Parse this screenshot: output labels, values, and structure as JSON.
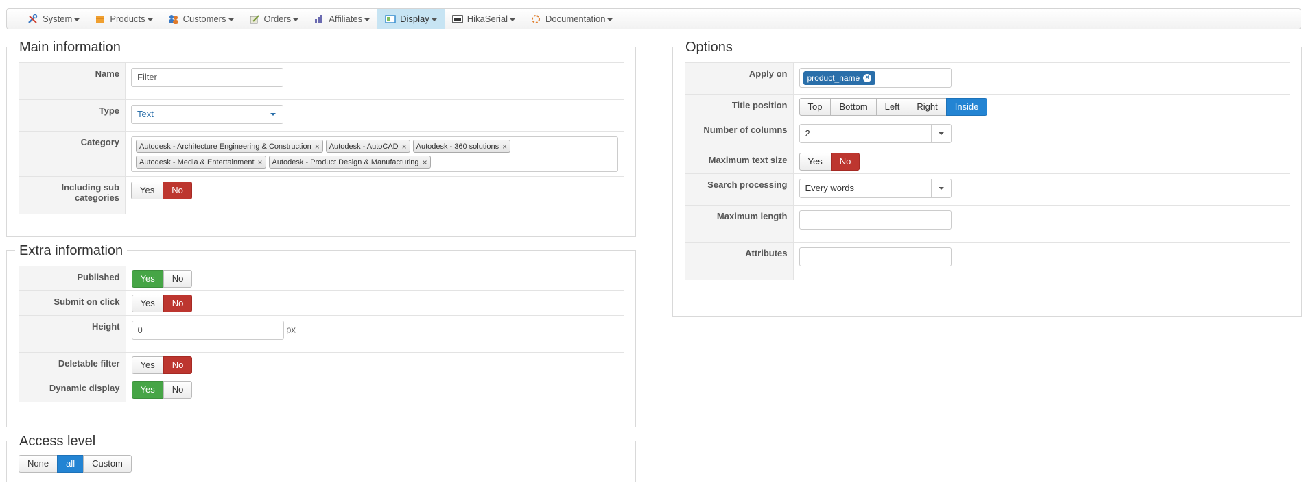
{
  "menu": [
    {
      "label": "System",
      "icon": "tools-icon",
      "color": "#3a79c4"
    },
    {
      "label": "Products",
      "icon": "products-box-icon",
      "color": "#f0a030"
    },
    {
      "label": "Customers",
      "icon": "customers-icon",
      "color": "#e07a2a"
    },
    {
      "label": "Orders",
      "icon": "orders-icon",
      "color": "#7a9a3a"
    },
    {
      "label": "Affiliates",
      "icon": "affiliates-icon",
      "color": "#6a6ab0"
    },
    {
      "label": "Display",
      "icon": "display-icon",
      "color": "#3a8fd0"
    },
    {
      "label": "HikaSerial",
      "icon": "hikaserial-icon",
      "color": "#333333"
    },
    {
      "label": "Documentation",
      "icon": "documentation-icon",
      "color": "#e08030"
    }
  ],
  "main_info": {
    "legend": "Main information",
    "name_label": "Name",
    "name_value": "Filter",
    "type_label": "Type",
    "type_value": "Text",
    "category_label": "Category",
    "categories": [
      "Autodesk - Architecture Engineering & Construction",
      "Autodesk - AutoCAD",
      "Autodesk - 360 solutions",
      "Autodesk - Media & Entertainment",
      "Autodesk - Product Design & Manufacturing"
    ],
    "sub_label_1": "Including sub",
    "sub_label_2": "categories",
    "yes": "Yes",
    "no": "No"
  },
  "extra_info": {
    "legend": "Extra information",
    "published_label": "Published",
    "submit_label": "Submit on click",
    "height_label": "Height",
    "height_value": "0",
    "height_unit": "px",
    "deletable_label": "Deletable filter",
    "dynamic_label": "Dynamic display",
    "yes": "Yes",
    "no": "No"
  },
  "access": {
    "legend": "Access level",
    "none": "None",
    "all": "all",
    "custom": "Custom"
  },
  "options": {
    "legend": "Options",
    "apply_label": "Apply on",
    "apply_chip": "product_name",
    "title_pos_label": "Title position",
    "positions": [
      "Top",
      "Bottom",
      "Left",
      "Right",
      "Inside"
    ],
    "columns_label": "Number of columns",
    "columns_value": "2",
    "max_text_label": "Maximum text size",
    "search_label": "Search processing",
    "search_value": "Every words",
    "max_length_label": "Maximum length",
    "attributes_label": "Attributes",
    "yes": "Yes",
    "no": "No"
  }
}
